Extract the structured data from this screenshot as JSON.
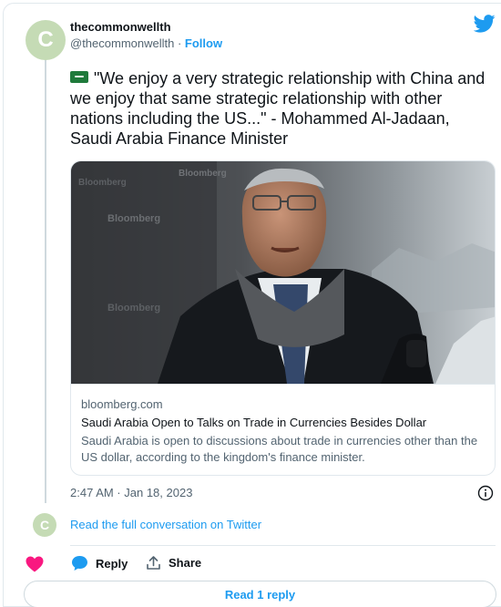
{
  "author": {
    "name": "thecommonwellth",
    "handle": "@thecommonwellth",
    "separator": " · ",
    "follow_label": "Follow",
    "avatar_letter": "C"
  },
  "tweet": {
    "text": "\"We enjoy a very strategic relationship with China and we enjoy that same strategic relationship with other nations including the US...\" - Mohammed Al-Jadaan, Saudi Arabia Finance Minister",
    "timestamp": "2:47 AM · Jan 18, 2023"
  },
  "link_card": {
    "domain": "bloomberg.com",
    "title": "Saudi Arabia Open to Talks on Trade in Currencies Besides Dollar",
    "description": "Saudi Arabia is open to discussions about trade in currencies other than the US dollar, according to the kingdom's finance minister.",
    "backdrop_text": "Bloomberg"
  },
  "conversation": {
    "read_full_label": "Read the full conversation on Twitter"
  },
  "actions": {
    "reply_label": "Reply",
    "share_label": "Share",
    "read_replies_label": "Read 1 reply"
  },
  "colors": {
    "accent": "#1d9bf0",
    "heart": "#f91880",
    "text_secondary": "#536471",
    "border": "#e1e8ed"
  },
  "icons": [
    "twitter-bird-icon",
    "saudi-flag-icon",
    "info-icon",
    "heart-icon",
    "reply-bubble-icon",
    "share-icon"
  ]
}
